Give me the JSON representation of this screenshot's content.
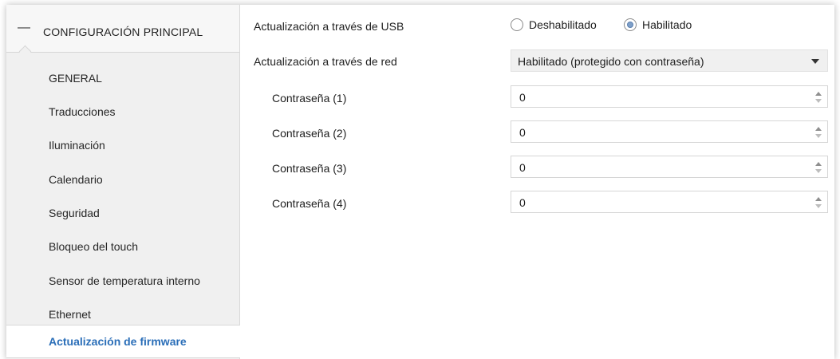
{
  "sidebar": {
    "header_icon": "minus",
    "header_title": "CONFIGURACIÓN PRINCIPAL",
    "items": [
      {
        "label": "GENERAL"
      },
      {
        "label": "Traducciones"
      },
      {
        "label": "Iluminación"
      },
      {
        "label": "Calendario"
      },
      {
        "label": "Seguridad"
      },
      {
        "label": "Bloqueo del touch"
      },
      {
        "label": "Sensor de temperatura interno"
      },
      {
        "label": "Ethernet"
      },
      {
        "label": "Actualización de firmware"
      }
    ],
    "active_index": 8
  },
  "main": {
    "usb": {
      "label": "Actualización a través de USB",
      "options": [
        "Deshabilitado",
        "Habilitado"
      ],
      "selected": "Habilitado"
    },
    "network": {
      "label": "Actualización a través de red",
      "value": "Habilitado (protegido con contraseña)"
    },
    "passwords": [
      {
        "label": "Contraseña (1)",
        "value": "0"
      },
      {
        "label": "Contraseña (2)",
        "value": "0"
      },
      {
        "label": "Contraseña (3)",
        "value": "0"
      },
      {
        "label": "Contraseña (4)",
        "value": "0"
      }
    ]
  },
  "colors": {
    "active_item": "#2a6eb8",
    "sidebar_bg": "#f0f0f0",
    "radio_selected": "#7fa0c8"
  }
}
